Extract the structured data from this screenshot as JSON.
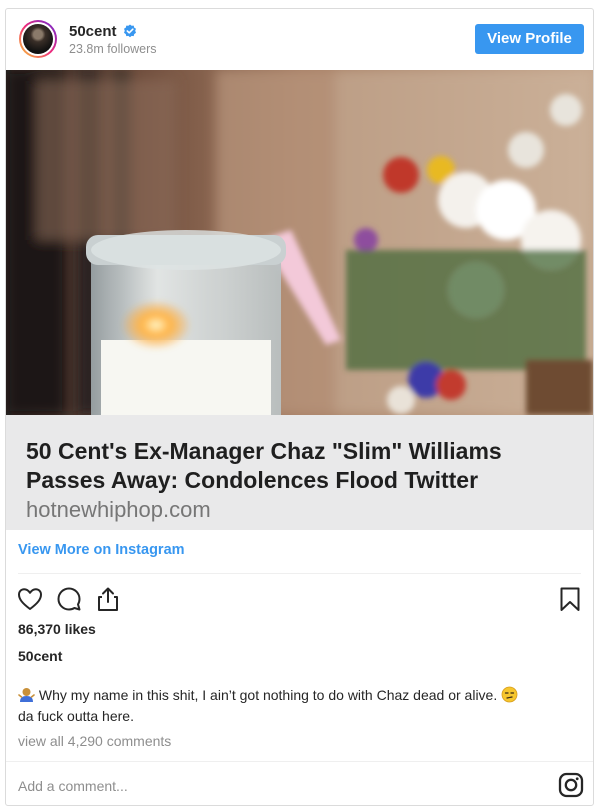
{
  "profile": {
    "username": "50cent",
    "followers": "23.8m followers",
    "view_profile_label": "View Profile"
  },
  "link_preview": {
    "title": "50 Cent's Ex-Manager Chaz \"Slim\" Williams Passes Away: Condolences Flood Twitter",
    "domain": "hotnewhiphop.com"
  },
  "view_more_label": "View More on Instagram",
  "likes": "86,370 likes",
  "author": "50cent",
  "caption": "Why my name in this shit, I ain’t got nothing to do with Chaz dead or alive.",
  "caption_end": "da fuck outta here.",
  "comments_link": "view all 4,290 comments",
  "comment_placeholder": "Add a comment...",
  "colors": {
    "accent": "#3897f0",
    "link_card_bg": "#e9e9ea"
  },
  "icons": [
    "verified-icon",
    "heart-icon",
    "comment-icon",
    "share-icon",
    "bookmark-icon",
    "instagram-icon"
  ]
}
